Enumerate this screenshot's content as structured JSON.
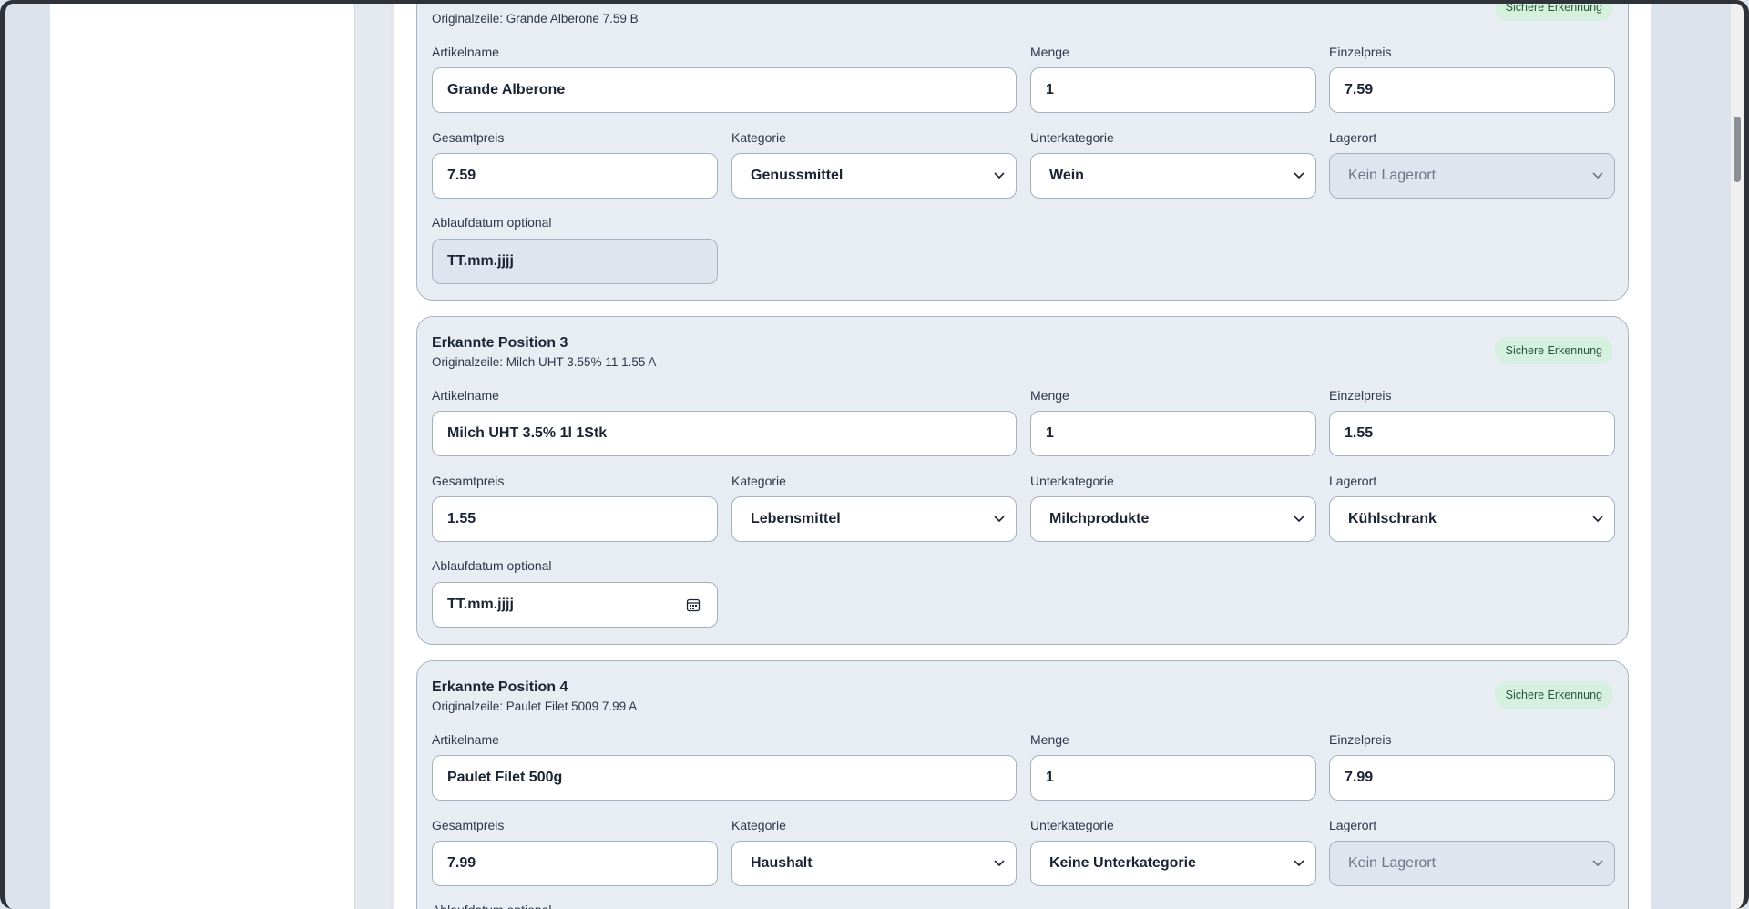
{
  "badge_text": "Sichere Erkennung",
  "labels": {
    "artikelname": "Artikelname",
    "menge": "Menge",
    "einzelpreis": "Einzelpreis",
    "gesamtpreis": "Gesamtpreis",
    "kategorie": "Kategorie",
    "unterkategorie": "Unterkategorie",
    "lagerort": "Lagerort",
    "ablaufdatum": "Ablaufdatum optional"
  },
  "items": [
    {
      "title": "",
      "original": "Originalzeile: Grande Alberone 7.59 B",
      "artikelname": "Grande Alberone",
      "menge": "1",
      "einzelpreis": "7.59",
      "gesamtpreis": "7.59",
      "kategorie": "Genussmittel",
      "unterkategorie": "Wein",
      "lagerort": "Kein Lagerort",
      "ablaufdatum": "TT.mm.jjjj"
    },
    {
      "title": "Erkannte Position 3",
      "original": "Originalzeile: Milch UHT 3.55% 11 1.55 A",
      "artikelname": "Milch UHT 3.5% 1l 1Stk",
      "menge": "1",
      "einzelpreis": "1.55",
      "gesamtpreis": "1.55",
      "kategorie": "Lebensmittel",
      "unterkategorie": "Milchprodukte",
      "lagerort": "Kühlschrank",
      "ablaufdatum": "TT.mm.jjjj"
    },
    {
      "title": "Erkannte Position 4",
      "original": "Originalzeile: Paulet Filet 5009 7.99 A",
      "artikelname": "Paulet Filet 500g",
      "menge": "1",
      "einzelpreis": "7.99",
      "gesamtpreis": "7.99",
      "kategorie": "Haushalt",
      "unterkategorie": "Keine Unterkategorie",
      "lagerort": "Kein Lagerort",
      "ablaufdatum": "Ablaufdatum optional"
    }
  ],
  "icons": {
    "chevron": "chevron-down-icon",
    "calendar": "calendar-icon"
  }
}
